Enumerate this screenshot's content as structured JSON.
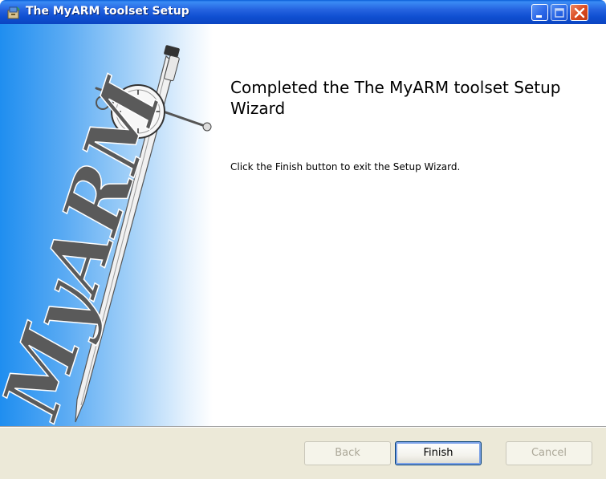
{
  "window": {
    "title": "The MyARM toolset Setup"
  },
  "banner": {
    "logo_text": "MyARM"
  },
  "content": {
    "heading": "Completed the The MyARM toolset Setup Wizard",
    "body": "Click the Finish button to exit the Setup Wizard."
  },
  "buttons": {
    "back": "Back",
    "finish": "Finish",
    "cancel": "Cancel"
  },
  "icons": {
    "app": "installer-icon",
    "minimize": "minimize-icon",
    "maximize": "maximize-icon",
    "close": "close-icon"
  },
  "colors": {
    "titlebar": "#0b4fd1",
    "banner_gradient_start": "#1f8ef0",
    "footer_bg": "#ece9d8",
    "close_button": "#d9491f"
  }
}
